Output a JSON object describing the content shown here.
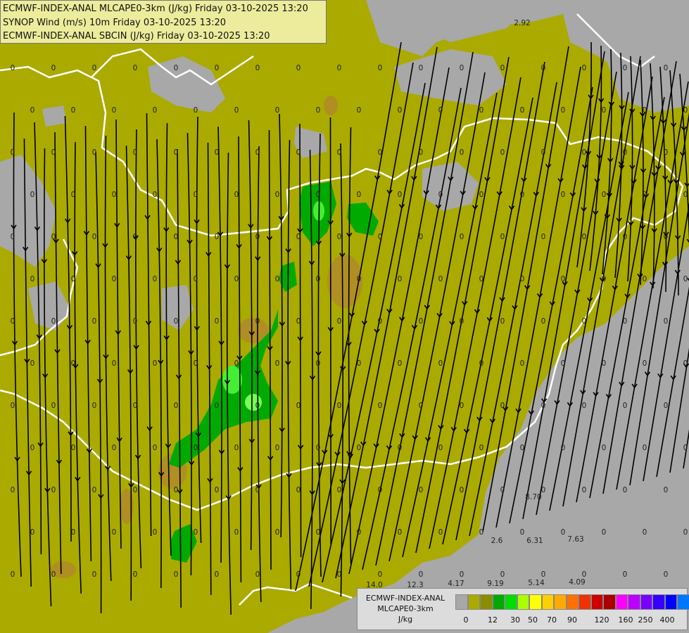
{
  "header": {
    "line1": "ECMWF-INDEX-ANAL MLCAPE0-3km (J/kg) Friday 03-10-2025 13:20",
    "line2": "SYNOP Wind (m/s) 10m Friday 03-10-2025 13:20",
    "line3": "ECMWF-INDEX-ANAL SBCIN (J/kg) Friday 03-10-2025 13:20"
  },
  "legend": {
    "title_line1": "ECMWF-INDEX-ANAL",
    "title_line2": "MLCAPE0-3km",
    "unit": "J/kg",
    "colors": [
      "#a8a8a8",
      "#aaaa00",
      "#8c8c00",
      "#00aa00",
      "#00dd00",
      "#aaff00",
      "#ffff00",
      "#ffd000",
      "#ffaa00",
      "#ff7000",
      "#ee3300",
      "#cc0000",
      "#aa0000",
      "#ff00ff",
      "#bb00ff",
      "#7700ff",
      "#3300ff",
      "#0000ff",
      "#0077ff",
      "#00ccff",
      "#77ffff",
      "#ffffff"
    ],
    "ticks": [
      "0",
      "12",
      "30",
      "50",
      "70",
      "90",
      "120",
      "160",
      "250",
      "400"
    ]
  },
  "values": {
    "zero": "0",
    "v_2_92": "2.92",
    "v_8_70": "8.70",
    "v_2_6": "2.6",
    "v_6_31": "6.31",
    "v_7_63": "7.63",
    "v_14_0": "14.0",
    "v_12_3": "12.3",
    "v_4_17": "4.17",
    "v_9_19": "9.19",
    "v_5_14": "5.14",
    "v_4_09": "4.09"
  },
  "colors": {
    "low_cape": "#aaaa00",
    "no_cape": "#a8a8a8",
    "moderate": "#00aa00",
    "high": "#44ee33",
    "cin_contour": "#b08a2a",
    "border": "#ffffff",
    "streamline": "#000000"
  }
}
